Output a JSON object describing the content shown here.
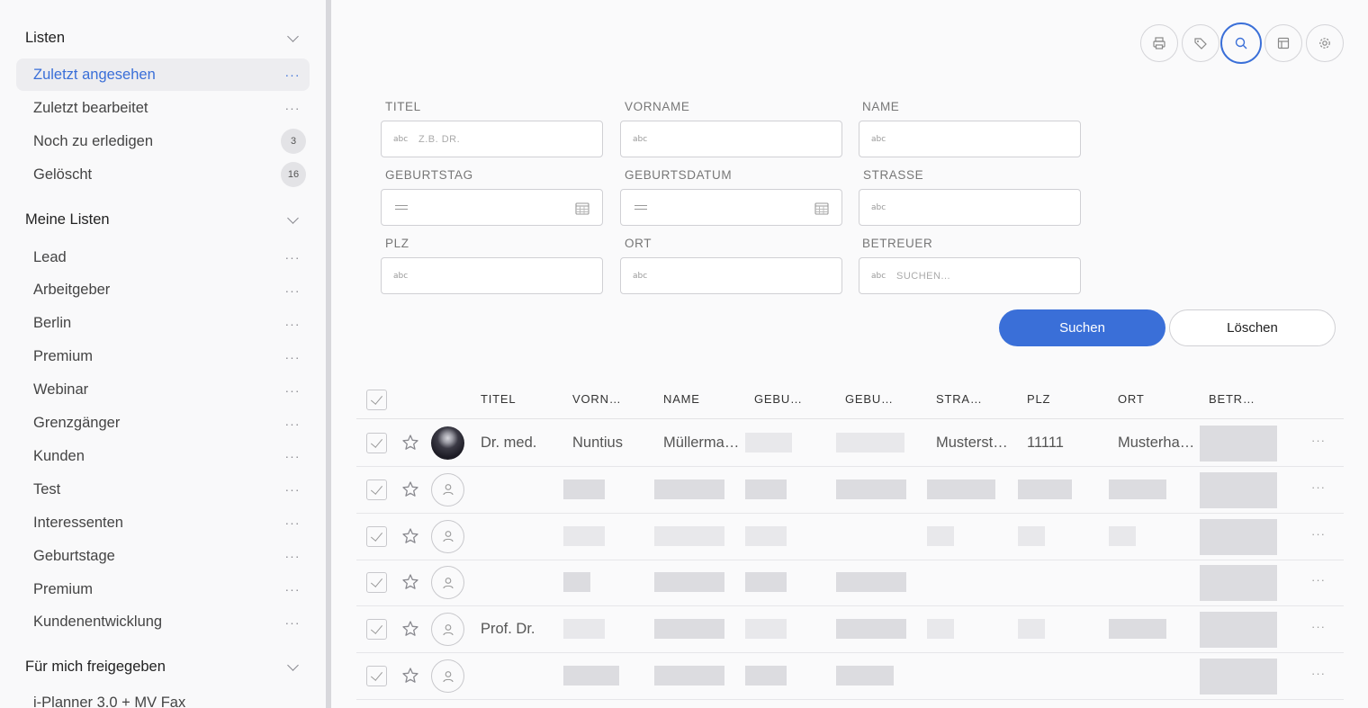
{
  "sidebar": {
    "sections": [
      {
        "title": "Listen",
        "items": [
          {
            "label": "Zuletzt angesehen",
            "active": true
          },
          {
            "label": "Zuletzt bearbeitet"
          },
          {
            "label": "Noch zu erledigen",
            "badge": "3"
          },
          {
            "label": "Gelöscht",
            "badge": "16"
          }
        ]
      },
      {
        "title": "Meine Listen",
        "items": [
          {
            "label": "Lead"
          },
          {
            "label": "Arbeitgeber"
          },
          {
            "label": "Berlin"
          },
          {
            "label": "Premium"
          },
          {
            "label": "Webinar"
          },
          {
            "label": "Grenzgänger"
          },
          {
            "label": "Kunden"
          },
          {
            "label": "Test"
          },
          {
            "label": "Interessenten"
          },
          {
            "label": "Geburtstage"
          },
          {
            "label": "Premium"
          },
          {
            "label": "Kundenentwicklung"
          }
        ]
      },
      {
        "title": "Für mich freigegeben",
        "items": [
          {
            "label": "i-Planner 3.0 + MV Fax"
          }
        ]
      }
    ],
    "more": "···"
  },
  "toolbar": [
    "print-icon",
    "tag-icon",
    "search-icon",
    "layout-icon",
    "gear-icon"
  ],
  "form": {
    "titel": {
      "label": "TITEL",
      "placeholder": "Z.B. DR."
    },
    "vorname": {
      "label": "VORNAME",
      "placeholder": ""
    },
    "name": {
      "label": "NAME",
      "placeholder": ""
    },
    "geburtstag": {
      "label": "GEBURTSTAG"
    },
    "geburtsdatum": {
      "label": "GEBURTSDATUM"
    },
    "strasse": {
      "label": "STRASSE",
      "placeholder": ""
    },
    "plz": {
      "label": "PLZ",
      "placeholder": ""
    },
    "ort": {
      "label": "ORT",
      "placeholder": ""
    },
    "betreuer": {
      "label": "BETREUER",
      "placeholder": "SUCHEN..."
    },
    "abc": "abc",
    "search_label": "Suchen",
    "clear_label": "Löschen"
  },
  "table": {
    "columns": [
      "TITEL",
      "VORN…",
      "NAME",
      "GEBU…",
      "GEBU…",
      "STRA…",
      "PLZ",
      "ORT",
      "BETR…"
    ],
    "rows": [
      {
        "titel": "Dr. med.",
        "vorname": "Nuntius",
        "name": "Müllerma…",
        "strasse": "Musterst…",
        "plz": "11111",
        "ort": "Musterha…",
        "photo": true
      },
      {
        "titel": ""
      },
      {
        "titel": ""
      },
      {
        "titel": ""
      },
      {
        "titel": "Prof. Dr."
      },
      {
        "titel": ""
      }
    ],
    "row_more": "···"
  },
  "colors": {
    "accent": "#3a6fd8"
  }
}
